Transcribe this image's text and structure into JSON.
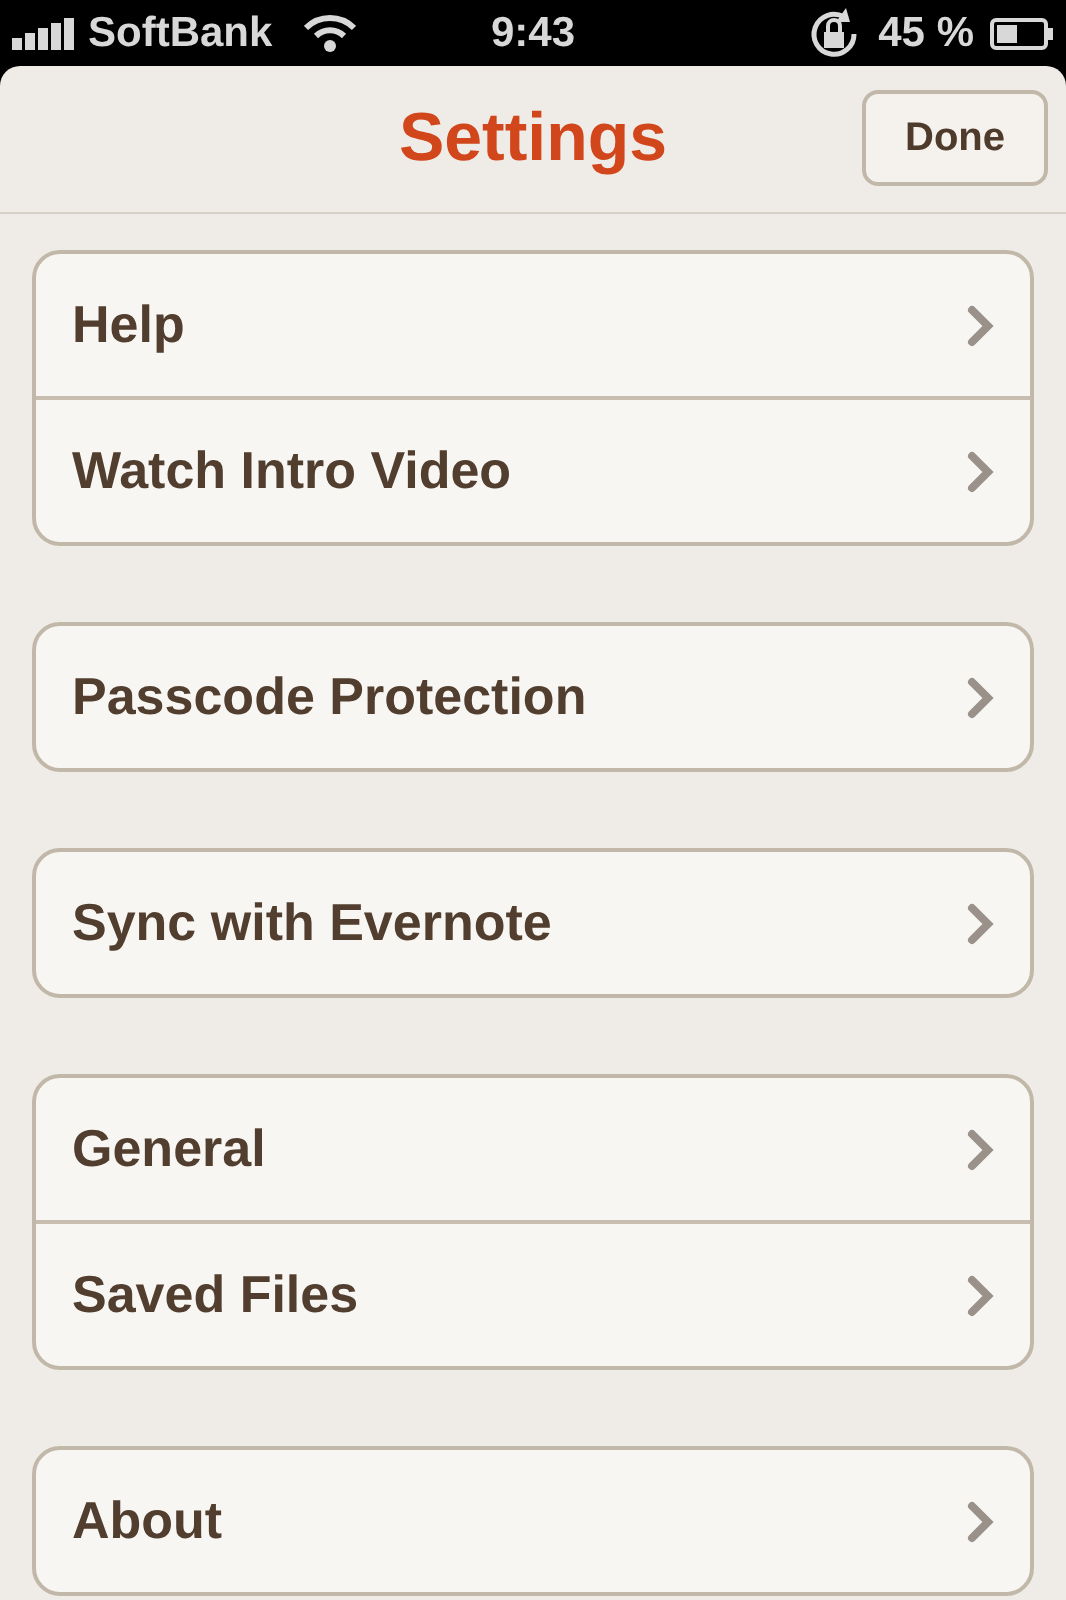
{
  "status_bar": {
    "carrier": "SoftBank",
    "time": "9:43",
    "battery": "45 %"
  },
  "header": {
    "title": "Settings",
    "done": "Done"
  },
  "groups": [
    {
      "items": [
        "Help",
        "Watch Intro Video"
      ]
    },
    {
      "items": [
        "Passcode Protection"
      ]
    },
    {
      "items": [
        "Sync with Evernote"
      ]
    },
    {
      "items": [
        "General",
        "Saved Files"
      ]
    },
    {
      "items": [
        "About"
      ]
    }
  ]
}
